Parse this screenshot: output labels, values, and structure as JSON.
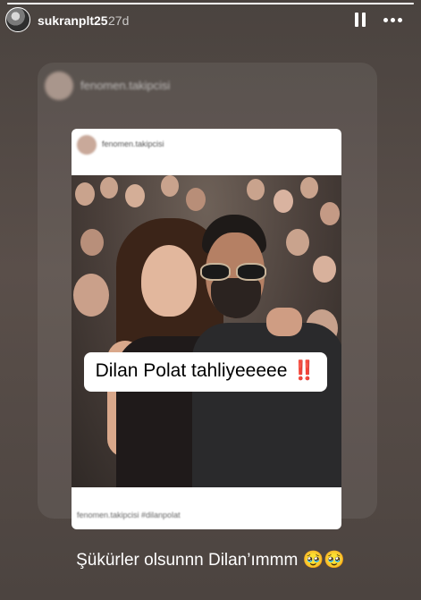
{
  "story": {
    "progress": 1,
    "username": "sukranplt25",
    "time": "27d",
    "icons": {
      "avatar": "user-avatar",
      "pause": "pause-icon",
      "more": "more-icon"
    }
  },
  "repost": {
    "username": "fenomen.takipcisi"
  },
  "post": {
    "username": "fenomen.takipcisi",
    "image_overlay_text": "Dilan Polat tahliyeeeee",
    "image_overlay_emoji": "‼️",
    "caption": "fenomen.takipcisi #dilanpolat"
  },
  "caption": "Şükürler olsunnn Dilan’ımmm 🥹🥹"
}
